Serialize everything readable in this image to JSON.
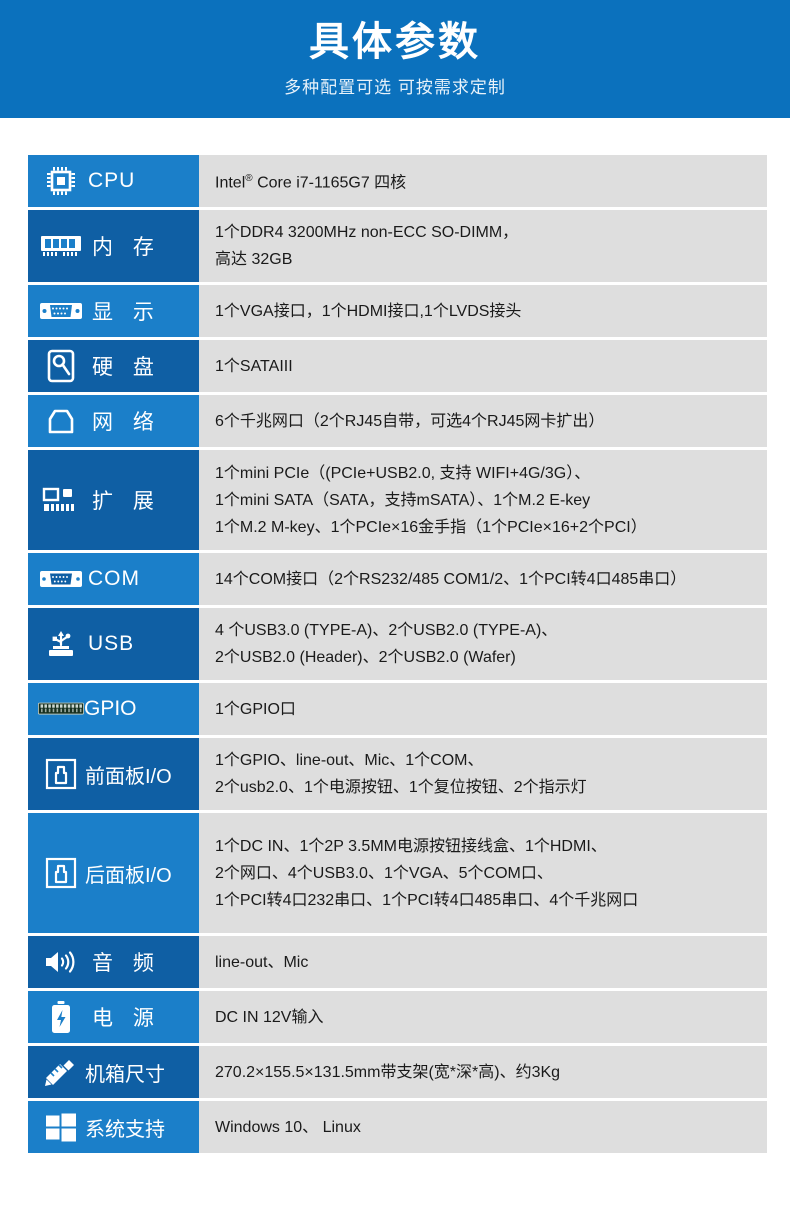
{
  "banner": {
    "title": "具体参数",
    "subtitle": "多种配置可选 可按需求定制",
    "bg_color": "#0b71bd"
  },
  "colors": {
    "blue_light": "#1b7fc9",
    "blue_dark": "#0f5fa4",
    "value_bg": "#dedede",
    "text": "#1a1a1a"
  },
  "spec_rows": [
    {
      "icon": "cpu-chip-icon",
      "label": "CPU",
      "label_style": "latin",
      "shade": "a",
      "height": "h1",
      "lines": [
        "Intel® Core i7-1165G7 四核"
      ]
    },
    {
      "icon": "memory-module-icon",
      "label": "内 存",
      "label_style": "cjk",
      "shade": "b",
      "height": "h2",
      "lines": [
        "1个DDR4 3200MHz non-ECC SO-DIMM，",
        "高达 32GB"
      ]
    },
    {
      "icon": "vga-port-icon",
      "label": "显 示",
      "label_style": "cjk",
      "shade": "a",
      "height": "h1",
      "lines": [
        "1个VGA接口，1个HDMI接口,1个LVDS接头"
      ]
    },
    {
      "icon": "hard-disk-icon",
      "label": "硬 盘",
      "label_style": "cjk",
      "shade": "b",
      "height": "h1",
      "lines": [
        "1个SATAIII"
      ]
    },
    {
      "icon": "rj45-network-icon",
      "label": "网 络",
      "label_style": "cjk",
      "shade": "a",
      "height": "h1",
      "lines": [
        "6个千兆网口（2个RJ45自带，可选4个RJ45网卡扩出）"
      ]
    },
    {
      "icon": "expansion-card-icon",
      "label": "扩 展",
      "label_style": "cjk",
      "shade": "b",
      "height": "h3",
      "lines": [
        "1个mini PCIe（(PCIe+USB2.0, 支持 WIFI+4G/3G）、",
        "1个mini SATA（SATA，支持mSATA）、1个M.2 E-key",
        "1个M.2 M-key、1个PCIe×16金手指（1个PCIe×16+2个PCI）"
      ]
    },
    {
      "icon": "com-serial-port-icon",
      "label": "COM",
      "label_style": "latin",
      "shade": "a",
      "height": "h1",
      "lines": [
        "14个COM接口（2个RS232/485 COM1/2、1个PCI转4口485串口）"
      ]
    },
    {
      "icon": "usb-icon",
      "label": "USB",
      "label_style": "latin",
      "shade": "b",
      "height": "h2",
      "lines": [
        "4 个USB3.0 (TYPE-A)、2个USB2.0 (TYPE-A)、",
        "2个USB2.0 (Header)、2个USB2.0 (Wafer)"
      ]
    },
    {
      "icon": "gpio-pin-header-icon",
      "label": "GPIO",
      "label_style": "narrow",
      "shade": "a",
      "height": "h1",
      "lines": [
        "1个GPIO口"
      ]
    },
    {
      "icon": "front-panel-io-icon",
      "label": "前面板I/O",
      "label_style": "tight",
      "shade": "b",
      "height": "h2",
      "lines": [
        "1个GPIO、line-out、Mic、1个COM、",
        "2个usb2.0、1个电源按钮、1个复位按钮、2个指示灯"
      ]
    },
    {
      "icon": "rear-panel-io-icon",
      "label": "后面板I/O",
      "label_style": "tight",
      "shade": "a",
      "height": "h4",
      "lines": [
        "1个DC IN、1个2P 3.5MM电源按钮接线盒、1个HDMI、",
        "2个网口、4个USB3.0、1个VGA、5个COM口、",
        "1个PCI转4口232串口、1个PCI转4口485串口、4个千兆网口"
      ]
    },
    {
      "icon": "speaker-audio-icon",
      "label": "音 频",
      "label_style": "cjk",
      "shade": "b",
      "height": "h1",
      "lines": [
        "line-out、Mic"
      ]
    },
    {
      "icon": "battery-power-icon",
      "label": "电 源",
      "label_style": "cjk",
      "shade": "a",
      "height": "h1",
      "lines": [
        "DC IN 12V输入"
      ]
    },
    {
      "icon": "ruler-pencil-icon",
      "label": "机箱尺寸",
      "label_style": "tight",
      "shade": "b",
      "height": "h1",
      "lines": [
        "270.2×155.5×131.5mm带支架(宽*深*高)、约3Kg"
      ]
    },
    {
      "icon": "windows-logo-icon",
      "label": "系统支持",
      "label_style": "tight",
      "shade": "a",
      "height": "h1",
      "lines": [
        "Windows 10、 Linux"
      ]
    }
  ]
}
